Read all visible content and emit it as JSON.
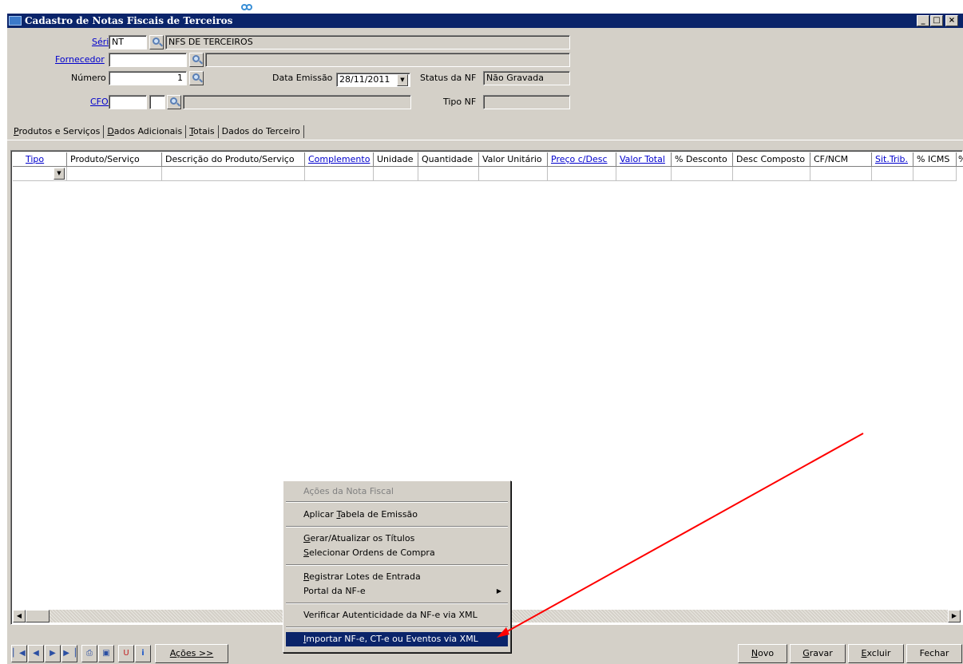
{
  "window": {
    "title": "Cadastro de Notas Fiscais de Terceiros",
    "min_glyph": "_",
    "max_glyph": "□",
    "close_glyph": "×"
  },
  "form": {
    "serie": {
      "label": "Série",
      "value": "NT",
      "description": "NFS DE TERCEIROS"
    },
    "fornecedor": {
      "label": "Fornecedor",
      "value": "",
      "description": ""
    },
    "numero": {
      "label": "Número",
      "value": "1"
    },
    "data_emissao": {
      "label": "Data Emissão",
      "value": "28/11/2011"
    },
    "status_nf": {
      "label": "Status da NF",
      "value": "Não Gravada"
    },
    "cfop": {
      "label": "CFOP",
      "value1": "",
      "value2": "",
      "description": ""
    },
    "tipo_nf": {
      "label": "Tipo NF",
      "value": ""
    }
  },
  "tabs": [
    {
      "prefix": "",
      "hot": "P",
      "rest": "rodutos e Serviços"
    },
    {
      "prefix": "",
      "hot": "D",
      "rest": "ados Adicionais"
    },
    {
      "prefix": "",
      "hot": "T",
      "rest": "otais"
    },
    {
      "prefix": "Dados do Terceiro",
      "hot": "",
      "rest": ""
    }
  ],
  "grid": {
    "columns": [
      "Tipo",
      "Produto/Serviço",
      "Descrição do Produto/Serviço",
      "Complemento",
      "Unidade",
      "Quantidade",
      "Valor Unitário",
      "Preço c/Desc",
      "Valor Total",
      "% Desconto",
      "Desc Composto",
      "CF/NCM",
      "Sit.Trib.",
      "% ICMS",
      "%"
    ]
  },
  "context_menu": {
    "header": "Ações da Nota Fiscal",
    "items": [
      {
        "hot_pre": "Aplicar ",
        "hot": "T",
        "hot_post": "abela de Emissão"
      },
      {
        "hot_pre": "",
        "hot": "G",
        "hot_post": "erar/Atualizar os Títulos"
      },
      {
        "hot_pre": "",
        "hot": "S",
        "hot_post": "elecionar Ordens de Compra"
      },
      {
        "hot_pre": "",
        "hot": "R",
        "hot_post": "egistrar Lotes de Entrada"
      },
      {
        "hot_pre": "Portal da NF-e",
        "hot": "",
        "hot_post": ""
      },
      {
        "hot_pre": "Verificar Autenticidade da NF-e via XML",
        "hot": "",
        "hot_post": ""
      },
      {
        "hot_pre": "",
        "hot": "I",
        "hot_post": "mportar NF-e, CT-e ou Eventos via XML"
      }
    ]
  },
  "bottom": {
    "acoes": "Ações >>",
    "novo": {
      "hot": "N",
      "rest": "ovo"
    },
    "gravar": {
      "hot": "G",
      "rest": "ravar"
    },
    "excluir": {
      "hot": "E",
      "rest": "xcluir"
    },
    "fechar": "Fechar"
  },
  "colors": {
    "titlebar": "#0a246a",
    "face": "#d4d0c8",
    "arrow": "#ff0000",
    "link": "#0000cc"
  }
}
